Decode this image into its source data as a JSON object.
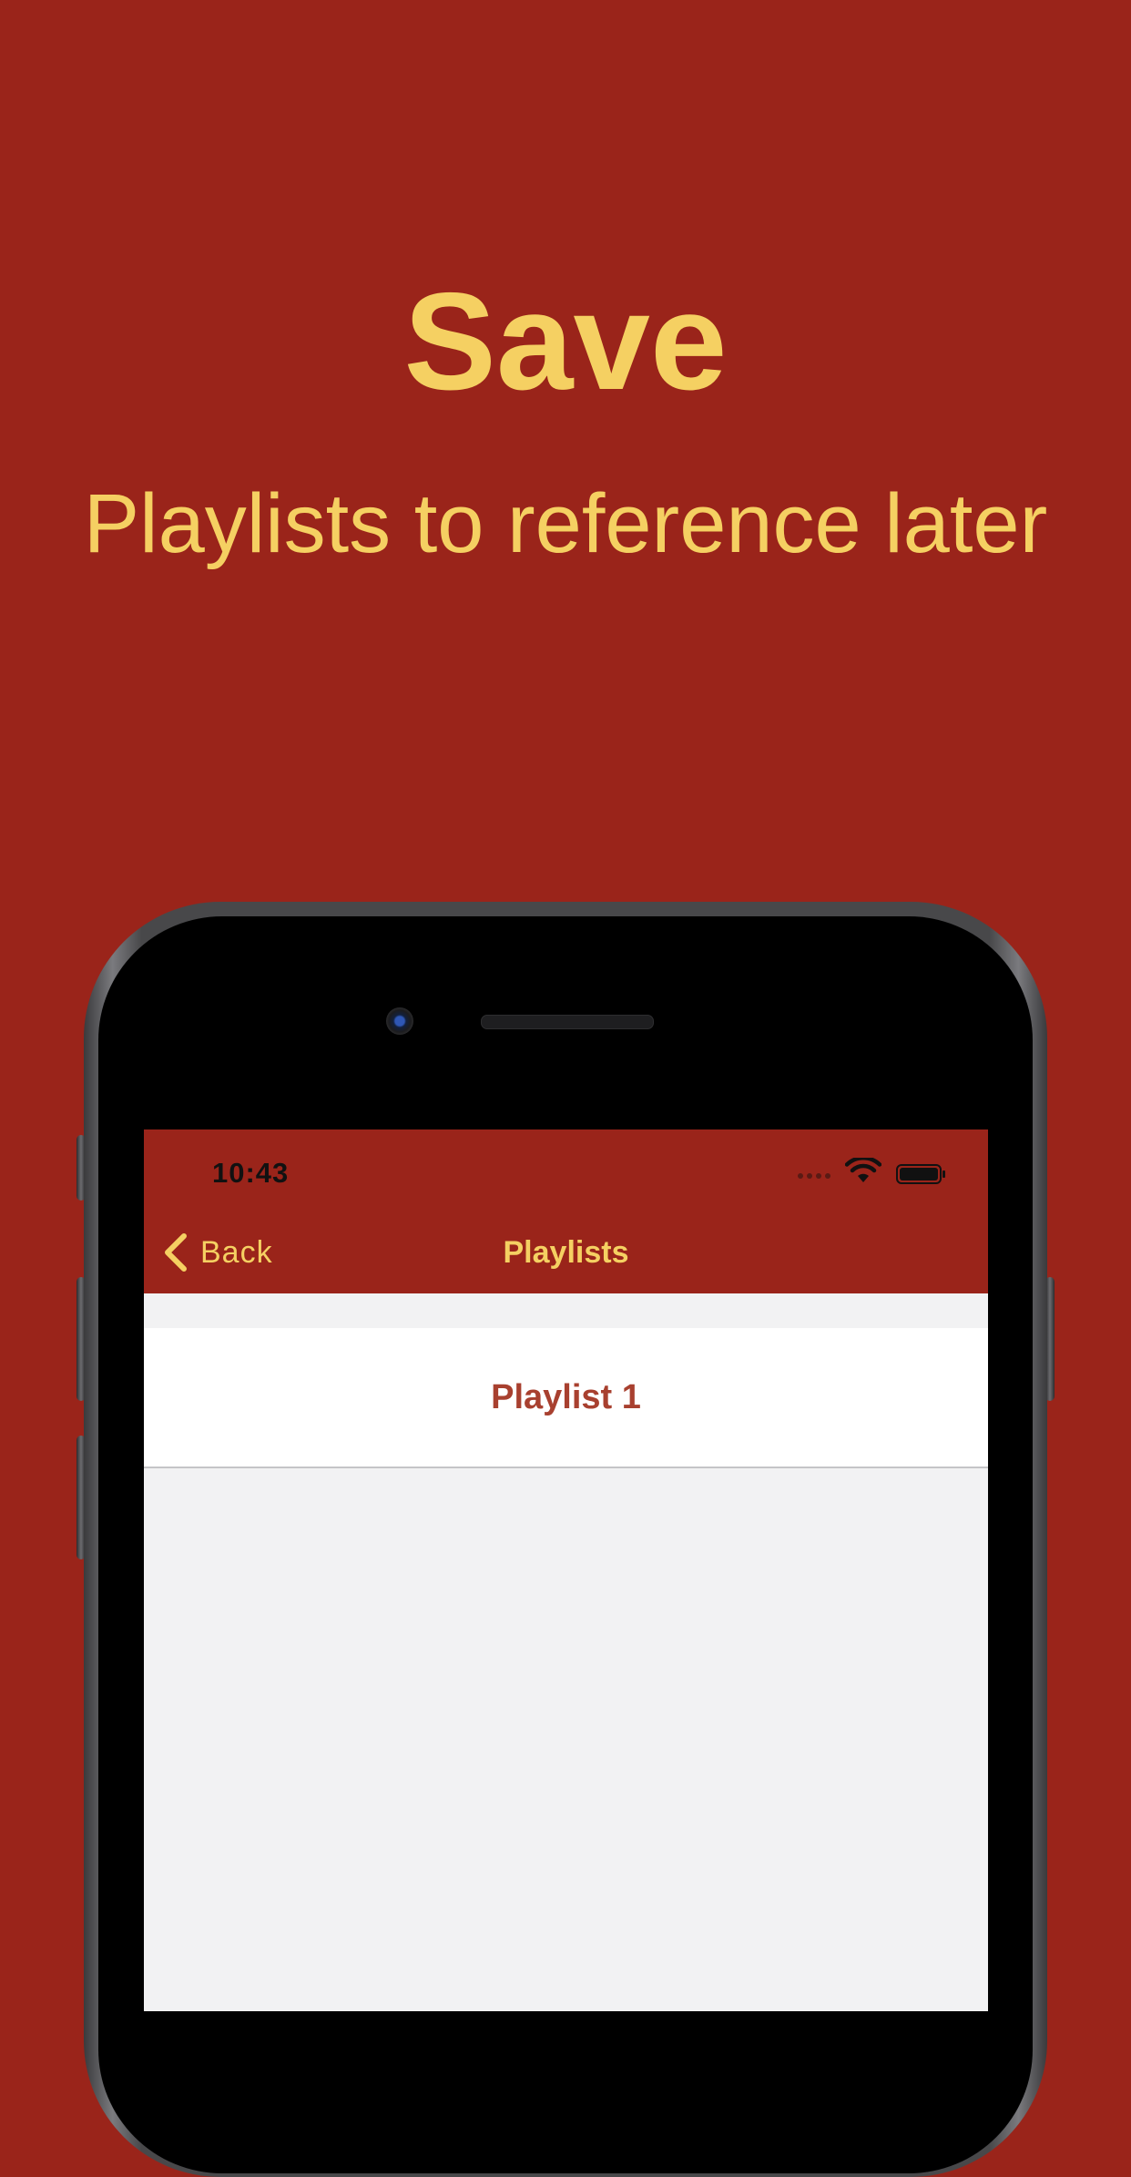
{
  "promo": {
    "headline": "Save",
    "subheadline": "Playlists to reference later"
  },
  "colors": {
    "background": "#9a241a",
    "accent": "#f5d062",
    "row_text": "#a8402f",
    "list_background": "#f2f2f3"
  },
  "status_bar": {
    "time": "10:43",
    "icons": [
      "signal-icon",
      "wifi-icon",
      "battery-icon"
    ]
  },
  "nav_bar": {
    "back_label": "Back",
    "title": "Playlists"
  },
  "playlists": [
    {
      "name": "Playlist 1"
    }
  ]
}
